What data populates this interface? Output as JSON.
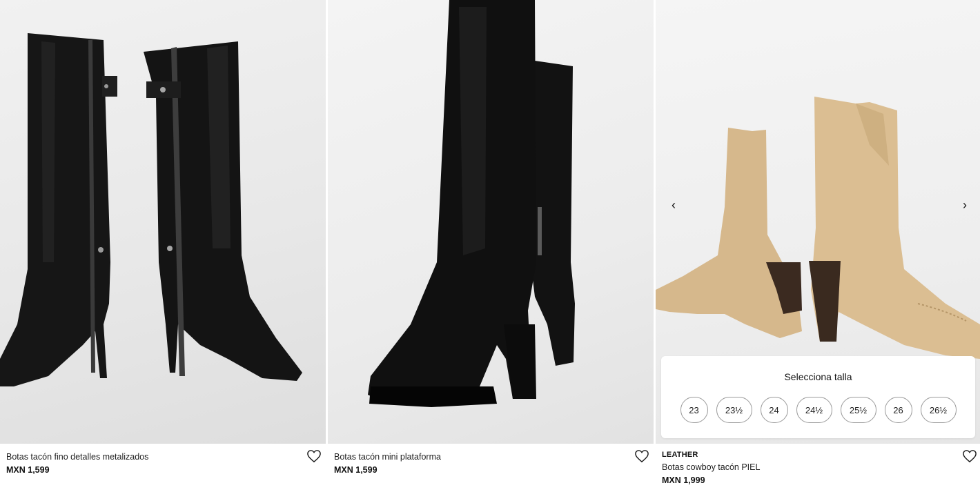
{
  "products": [
    {
      "name": "Botas tacón fino detalles metalizados",
      "price": "MXN 1,599",
      "image_icon": "black-knee-high-stiletto-boots-image",
      "favorite_icon": "heart-outline-icon"
    },
    {
      "name": "Botas tacón mini plataforma",
      "price": "MXN 1,599",
      "image_icon": "black-knee-high-platform-boots-image",
      "favorite_icon": "heart-outline-icon"
    },
    {
      "brand_tag": "LEATHER",
      "name": "Botas cowboy tacón PIEL",
      "price": "MXN 1,999",
      "image_icon": "beige-suede-cowboy-boots-image",
      "favorite_icon": "heart-outline-icon",
      "carousel": {
        "prev_symbol": "‹",
        "next_symbol": "›"
      },
      "size_selector": {
        "title": "Selecciona talla",
        "sizes": [
          "23",
          "23½",
          "24",
          "24½",
          "25½",
          "26",
          "26½"
        ]
      }
    }
  ],
  "colors": {
    "boot_black": "#151515",
    "boot_suede": "#d8bb8f",
    "heel_brown": "#3b2a20",
    "text": "#1a1a1a"
  }
}
